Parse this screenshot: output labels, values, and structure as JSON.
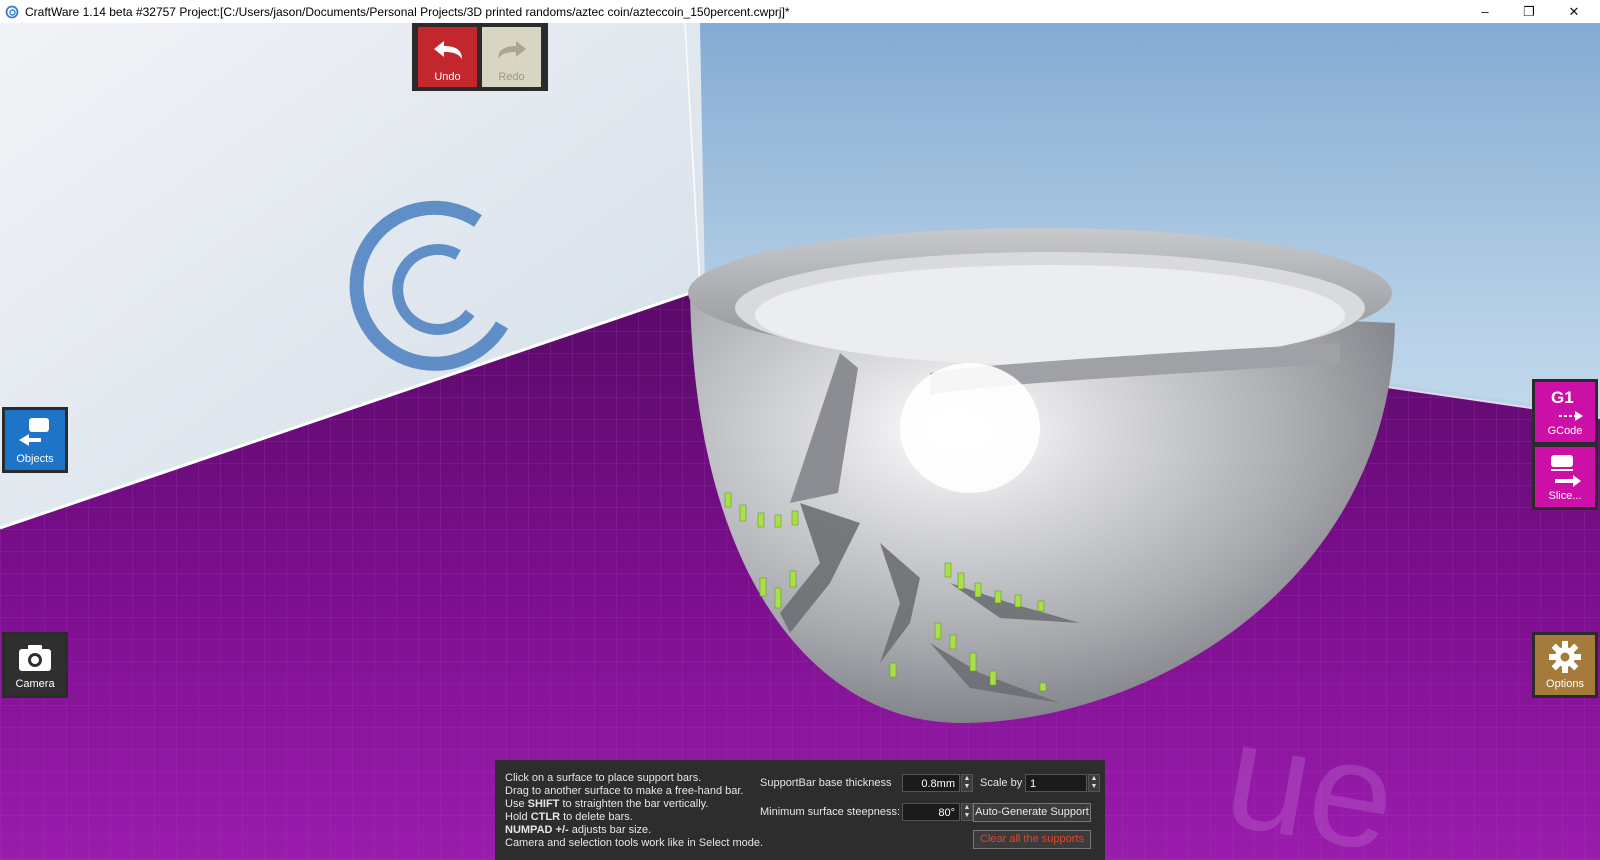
{
  "window": {
    "title": "CraftWare 1.14 beta #32757   Project:[C:/Users/jason/Documents/Personal Projects/3D printed randoms/aztec coin/azteccoin_150percent.cwprj]*",
    "minimize": "–",
    "restore": "❐",
    "close": "✕"
  },
  "toolbar": {
    "undo_label": "Undo",
    "redo_label": "Redo"
  },
  "left_panel": {
    "objects_label": "Objects",
    "camera_label": "Camera"
  },
  "right_panel": {
    "gcode_label": "GCode",
    "gcode_glyph": "G1",
    "slice_label": "Slice...",
    "options_label": "Options"
  },
  "support_panel": {
    "help_lines": [
      {
        "pre": "Click on a surface to place support bars.",
        "bold": "",
        "post": ""
      },
      {
        "pre": "Drag to another surface to make a free-hand bar.",
        "bold": "",
        "post": ""
      },
      {
        "pre": "Use ",
        "bold": "SHIFT",
        "post": " to straighten the bar vertically."
      },
      {
        "pre": "Hold ",
        "bold": "CTLR",
        "post": " to delete bars."
      },
      {
        "pre": "",
        "bold": "NUMPAD +/-",
        "post": " adjusts bar size."
      },
      {
        "pre": "Camera and selection tools work like in Select mode.",
        "bold": "",
        "post": ""
      }
    ],
    "base_thickness_label": "SupportBar base thickness",
    "base_thickness_value": "0.8mm",
    "scale_label": "Scale by",
    "scale_value": "1",
    "min_steepness_label": "Minimum surface steepness:",
    "min_steepness_value": "80°",
    "auto_generate_label": "Auto-Generate Support",
    "clear_supports_label": "Clear all the supports"
  },
  "colors": {
    "undo": "#c4262e",
    "redo": "#d9d5c3",
    "objects": "#1e74c6",
    "gcode": "#cc0fa6",
    "options": "#a57b3c",
    "bed": "#7a0a8c",
    "support": "#a8e04a"
  }
}
